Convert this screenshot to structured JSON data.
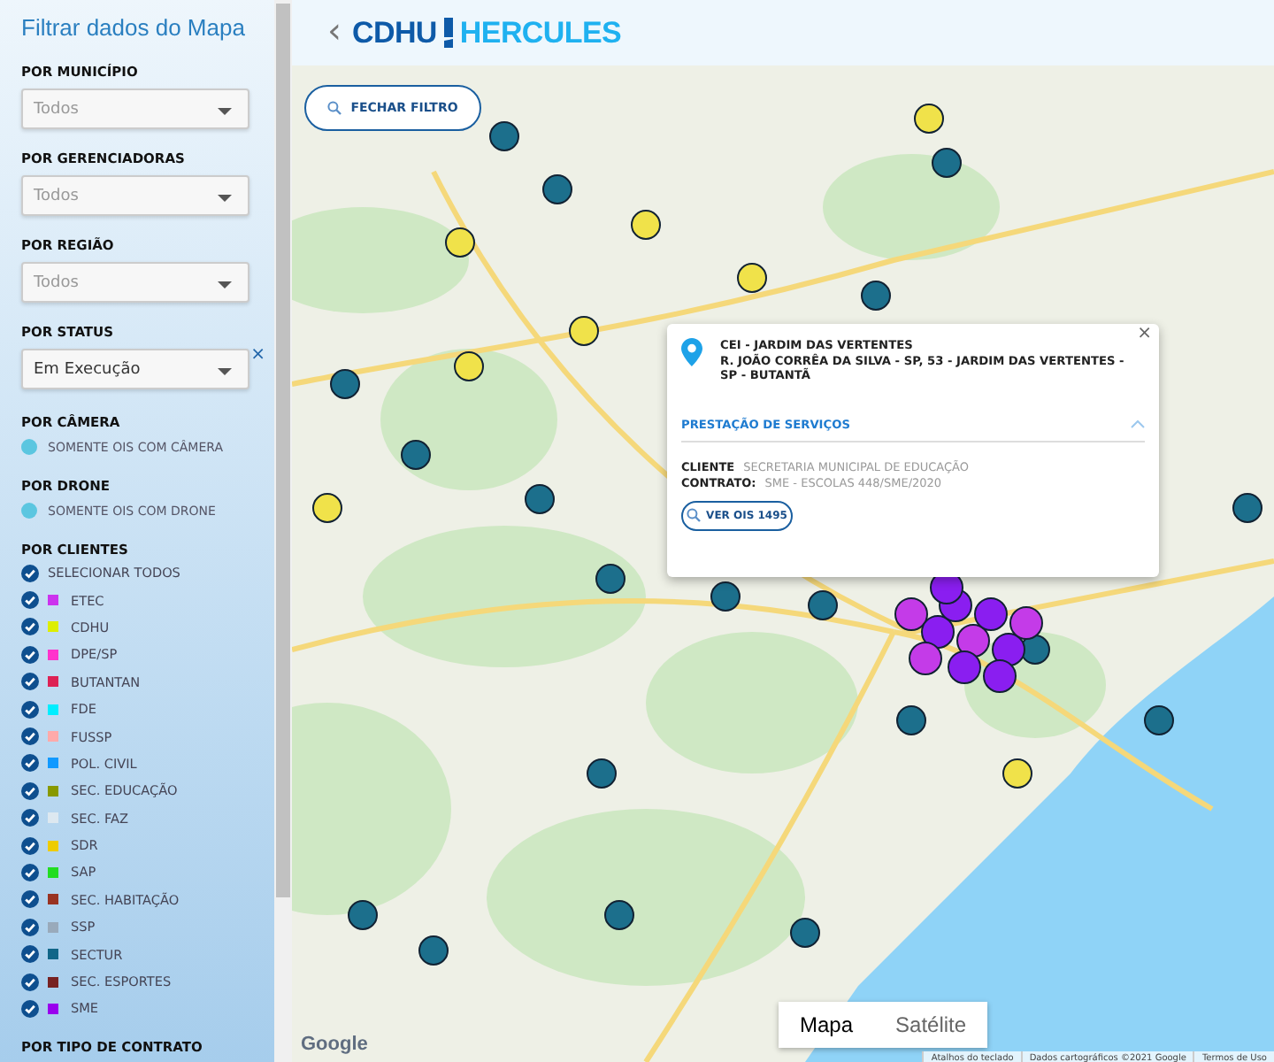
{
  "sidebar": {
    "title": "Filtrar dados do Mapa",
    "selects": [
      {
        "label": "POR MUNICÍPIO",
        "placeholder": "Todos"
      },
      {
        "label": "POR GERENCIADORAS",
        "placeholder": "Todos"
      },
      {
        "label": "POR REGIÃO",
        "placeholder": "Todos"
      },
      {
        "label": "POR STATUS",
        "value": "Em Execução",
        "clear": "×"
      }
    ],
    "toggles": [
      {
        "label": "POR CÂMERA",
        "option": "SOMENTE OIS COM CÂMERA",
        "on": false
      },
      {
        "label": "POR DRONE",
        "option": "SOMENTE OIS COM DRONE",
        "on": false
      }
    ],
    "clients": {
      "label": "POR CLIENTES",
      "select_all": {
        "label": "SELECIONAR TODOS",
        "checked": true
      },
      "items": [
        {
          "label": "ETEC",
          "color": "#cc33ee",
          "checked": true
        },
        {
          "label": "CDHU",
          "color": "#ddee00",
          "checked": true
        },
        {
          "label": "DPE/SP",
          "color": "#ff33cc",
          "checked": true
        },
        {
          "label": "BUTANTAN",
          "color": "#dd2255",
          "checked": true
        },
        {
          "label": "FDE",
          "color": "#00eeff",
          "checked": true
        },
        {
          "label": "FUSSP",
          "color": "#ffaaaa",
          "checked": true
        },
        {
          "label": "POL. CIVIL",
          "color": "#1199ff",
          "checked": true
        },
        {
          "label": "SEC. EDUCAÇÃO",
          "color": "#889900",
          "checked": true
        },
        {
          "label": "SEC. FAZ",
          "color": "#dde8f0",
          "checked": true
        },
        {
          "label": "SDR",
          "color": "#eecc00",
          "checked": true
        },
        {
          "label": "SAP",
          "color": "#22dd22",
          "checked": true
        },
        {
          "label": "SEC. HABITAÇÃO",
          "color": "#993322",
          "checked": true
        },
        {
          "label": "SSP",
          "color": "#99aabb",
          "checked": true
        },
        {
          "label": "SECTUR",
          "color": "#116688",
          "checked": true
        },
        {
          "label": "SEC. ESPORTES",
          "color": "#772222",
          "checked": true
        },
        {
          "label": "SME",
          "color": "#9900ee",
          "checked": true
        }
      ]
    },
    "next_section": "POR TIPO DE CONTRATO"
  },
  "header": {
    "back": "‹",
    "logo_left": "CDHU",
    "logo_right": "HERCULES"
  },
  "map": {
    "filter_button": "FECHAR FILTRO",
    "popup": {
      "title": "CEI - JARDIM DAS VERTENTES",
      "address": "R. JOÃO CORRÊA DA SILVA - SP, 53 - JARDIM DAS VERTENTES - SP - BUTANTÃ",
      "close": "×",
      "section": {
        "title": "PRESTAÇÃO DE SERVIÇOS",
        "expanded": true,
        "fields": [
          {
            "label": "CLIENTE",
            "value": "SECRETARIA MUNICIPAL DE EDUCAÇÃO"
          },
          {
            "label": "CONTRATO:",
            "value": "SME - ESCOLAS 448/SME/2020"
          }
        ],
        "button": "VER OIS 1495"
      }
    },
    "map_types": [
      {
        "label": "Mapa",
        "selected": true
      },
      {
        "label": "Satélite",
        "selected": false
      }
    ],
    "google": "Google",
    "attribution": [
      "Atalhos do teclado",
      "Dados cartográficos ©2021 Google",
      "Termos de Uso"
    ]
  }
}
